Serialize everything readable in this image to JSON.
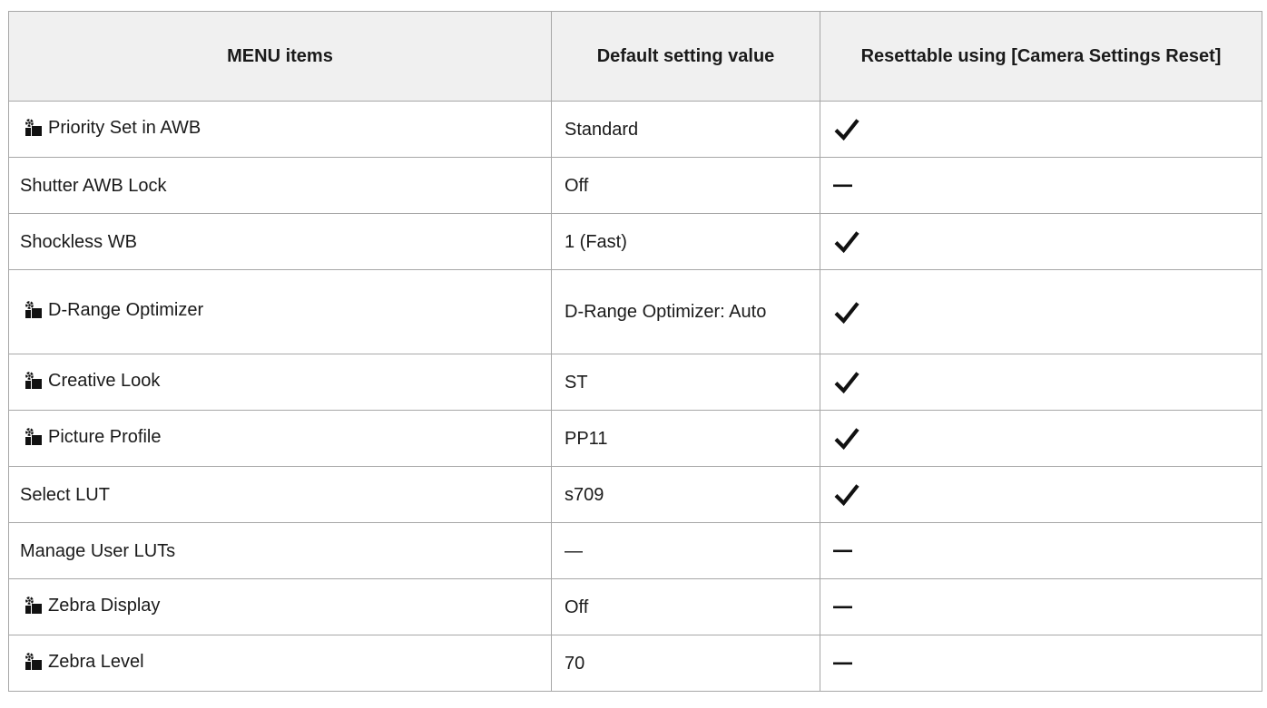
{
  "headers": {
    "menu_items": "MENU items",
    "default_value": "Default setting value",
    "resettable": "Resettable using [Camera Settings Reset]"
  },
  "rows": [
    {
      "name": "Priority Set in AWB",
      "has_mode_icon": true,
      "value": "Standard",
      "resettable": true
    },
    {
      "name": "Shutter AWB Lock",
      "has_mode_icon": false,
      "value": "Off",
      "resettable": false
    },
    {
      "name": "Shockless WB",
      "has_mode_icon": false,
      "value": "1 (Fast)",
      "resettable": true
    },
    {
      "name": "D-Range Optimizer",
      "has_mode_icon": true,
      "value": "D-Range Optimizer: Auto",
      "resettable": true
    },
    {
      "name": "Creative Look",
      "has_mode_icon": true,
      "value": "ST",
      "resettable": true
    },
    {
      "name": "Picture Profile",
      "has_mode_icon": true,
      "value": "PP11",
      "resettable": true
    },
    {
      "name": "Select LUT",
      "has_mode_icon": false,
      "value": "s709",
      "resettable": true
    },
    {
      "name": "Manage User LUTs",
      "has_mode_icon": false,
      "value": "—",
      "resettable": false
    },
    {
      "name": "Zebra Display",
      "has_mode_icon": true,
      "value": "Off",
      "resettable": false
    },
    {
      "name": "Zebra Level",
      "has_mode_icon": true,
      "value": "70",
      "resettable": false
    }
  ],
  "icons": {
    "mode": "still-movie-mode-icon",
    "yes": "checkmark-icon",
    "no": "dash-icon"
  },
  "colors": {
    "border": "#a7a7a7",
    "header_bg": "#f0f0f0",
    "text": "#1a1a1a"
  }
}
